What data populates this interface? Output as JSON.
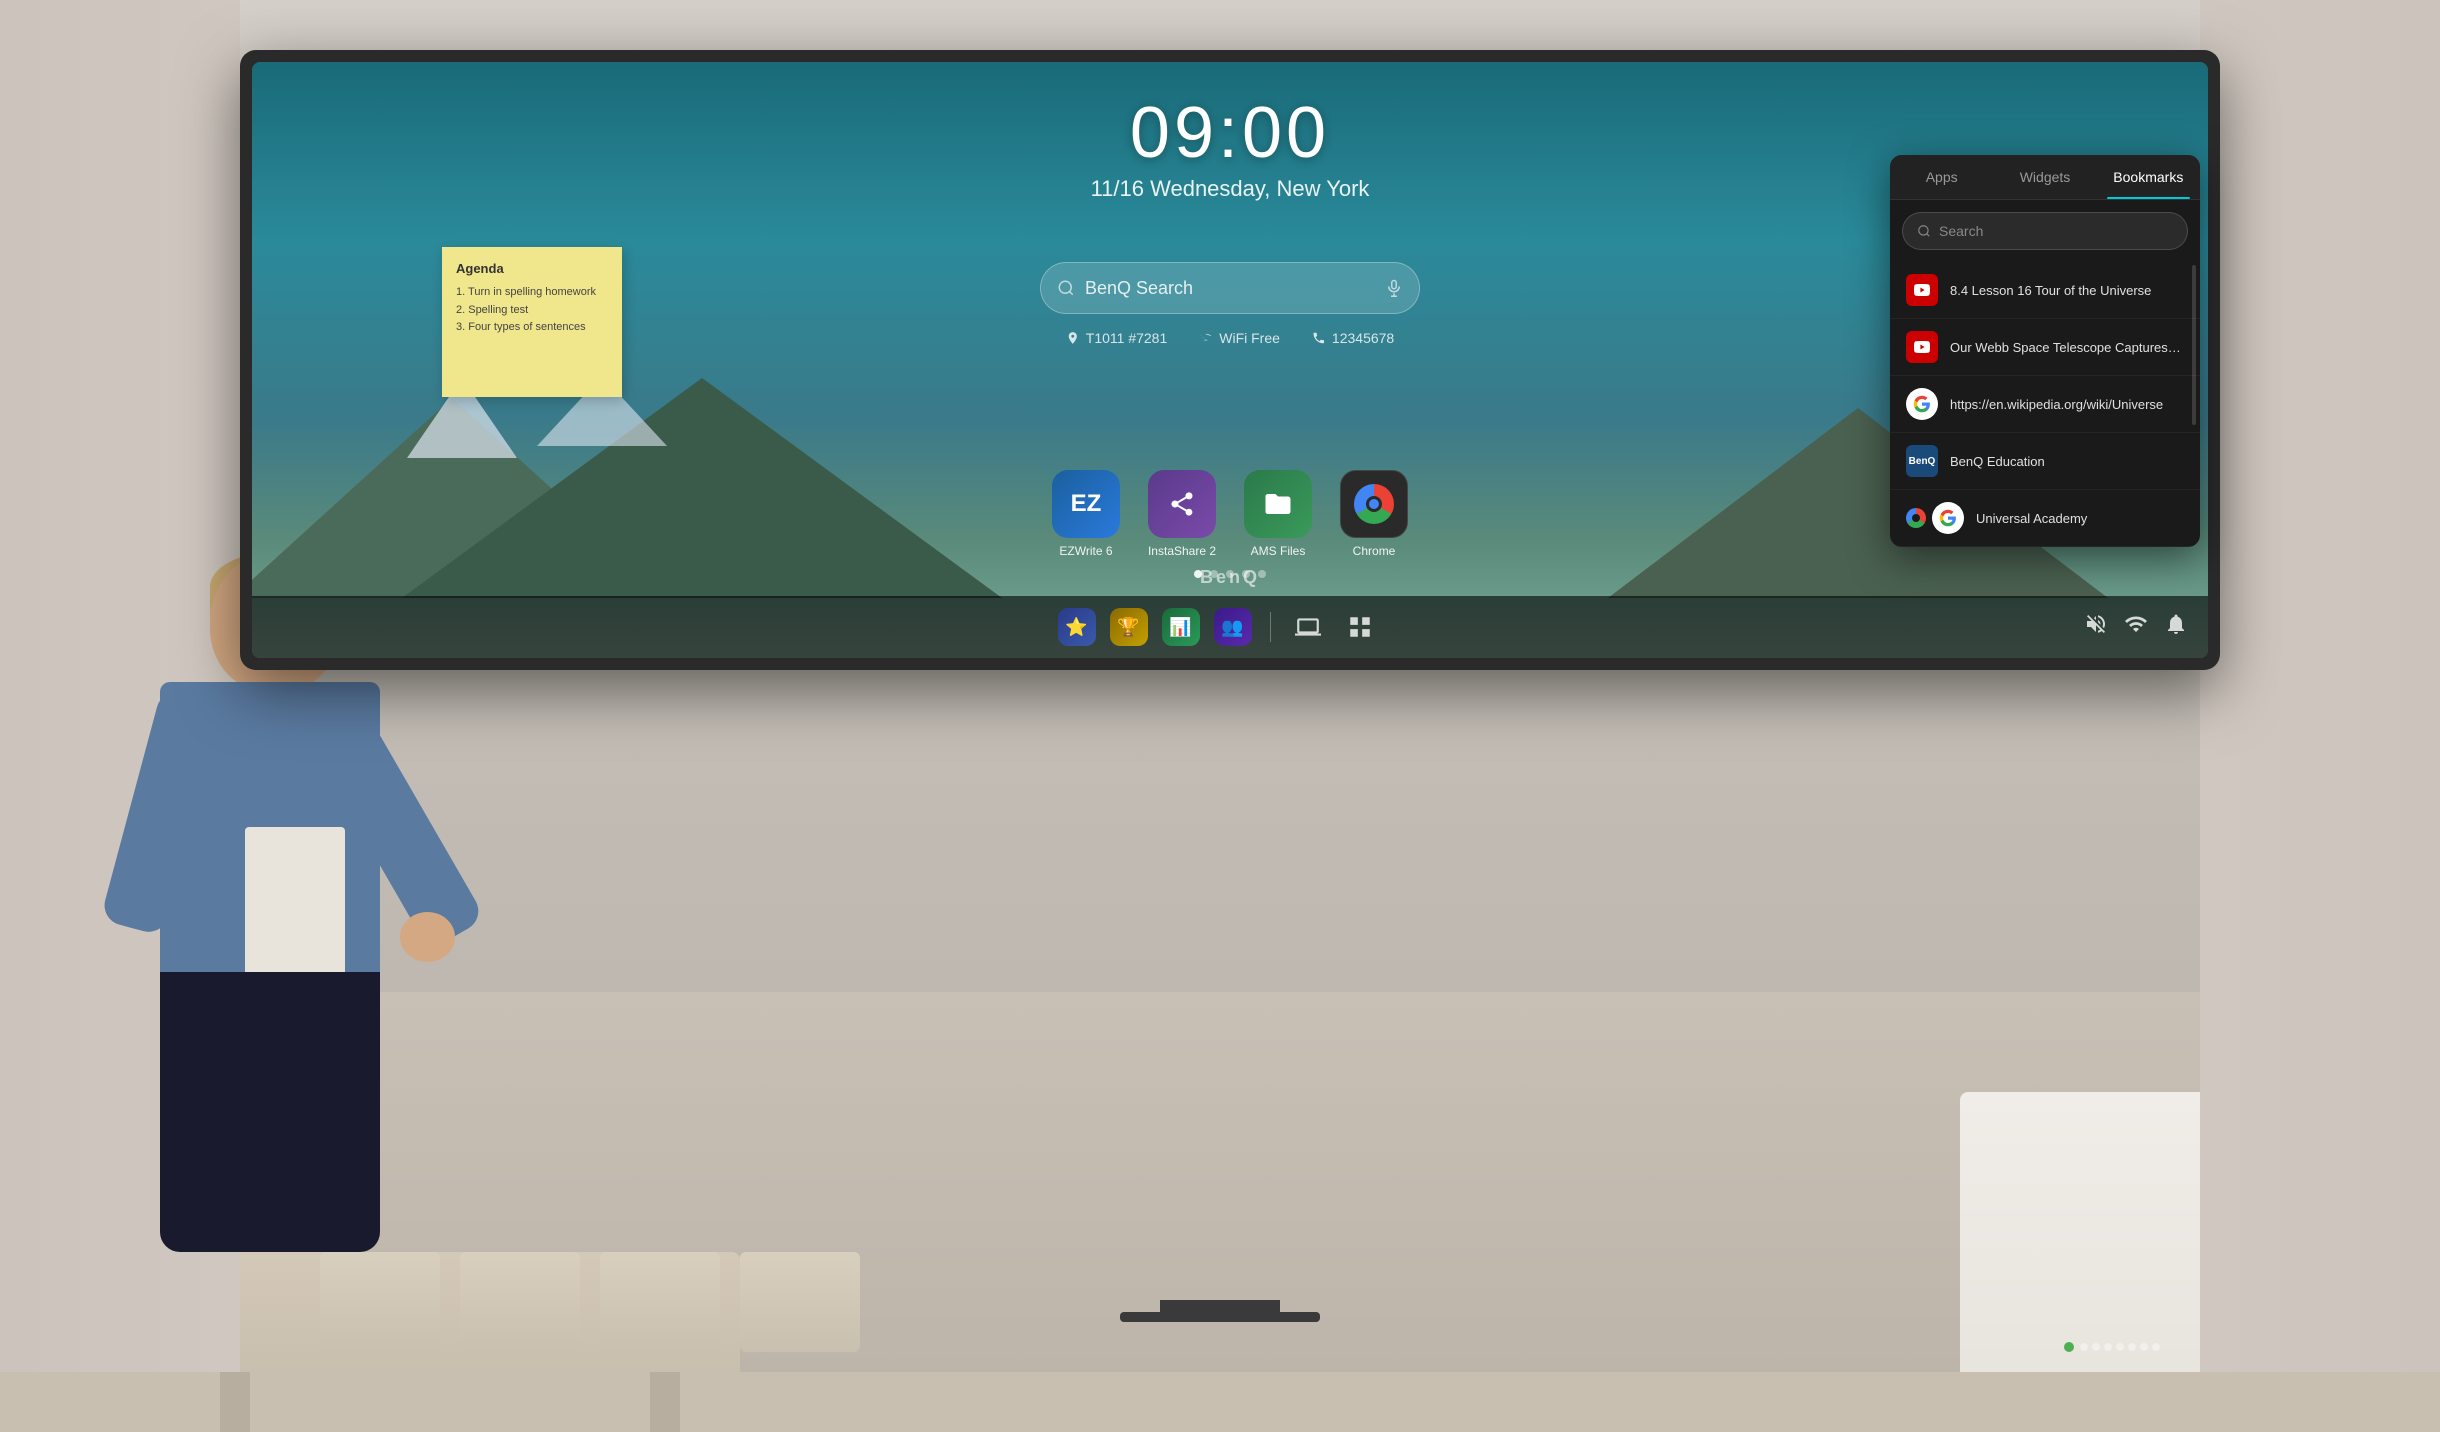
{
  "room": {
    "wall_color": "#d0c8c0"
  },
  "monitor": {
    "brand": "BenQ"
  },
  "clock": {
    "time": "09:00",
    "date": "11/16 Wednesday, New York"
  },
  "search": {
    "placeholder": "BenQ Search"
  },
  "info_bar": {
    "device": "T1011 #7281",
    "network": "WiFi Free",
    "phone": "12345678"
  },
  "sticky_note": {
    "title": "Agenda",
    "items": [
      "1. Turn in spelling homework",
      "2. Spelling test",
      "3. Four types of sentences"
    ]
  },
  "apps": [
    {
      "name": "EZWrite 6",
      "color": "#1a5f9e",
      "label": "EZWrite 6"
    },
    {
      "name": "InstaShare 2",
      "color": "#5a3a8a",
      "label": "InstaShare 2"
    },
    {
      "name": "AMS Files",
      "color": "#2a7a4a",
      "label": "AMS Files"
    },
    {
      "name": "Chrome",
      "color": "#2a2a2a",
      "label": "Chrome"
    }
  ],
  "page_dots": 5,
  "active_dot": 0,
  "bookmarks_panel": {
    "tabs": [
      "Apps",
      "Widgets",
      "Bookmarks"
    ],
    "active_tab": "Bookmarks",
    "search_placeholder": "Search",
    "items": [
      {
        "id": "lesson-tour",
        "icon_type": "youtube",
        "title": "8.4 Lesson 16 Tour of the Universe"
      },
      {
        "id": "webb-telescope",
        "icon_type": "youtube",
        "title": "Our Webb Space Telescope Captures a Cosmic Ring on..."
      },
      {
        "id": "wikipedia",
        "icon_type": "google",
        "title": "https://en.wikipedia.org/wiki/Universe"
      },
      {
        "id": "benq-education",
        "icon_type": "benq",
        "title": "BenQ Education"
      },
      {
        "id": "universal-academy",
        "icon_type": "chrome",
        "title": "Universal Academy"
      }
    ]
  },
  "taskbar": {
    "center_apps": [
      {
        "name": "star-app",
        "emoji": "⭐"
      },
      {
        "name": "award-app",
        "emoji": "🏆"
      },
      {
        "name": "sheets-app",
        "emoji": "📊"
      },
      {
        "name": "teams-app",
        "emoji": "👥"
      }
    ],
    "right_icons": [
      {
        "name": "mute-icon",
        "symbol": "🔇"
      },
      {
        "name": "wifi-icon",
        "symbol": "📶"
      },
      {
        "name": "bell-icon",
        "symbol": "🔔"
      }
    ]
  }
}
